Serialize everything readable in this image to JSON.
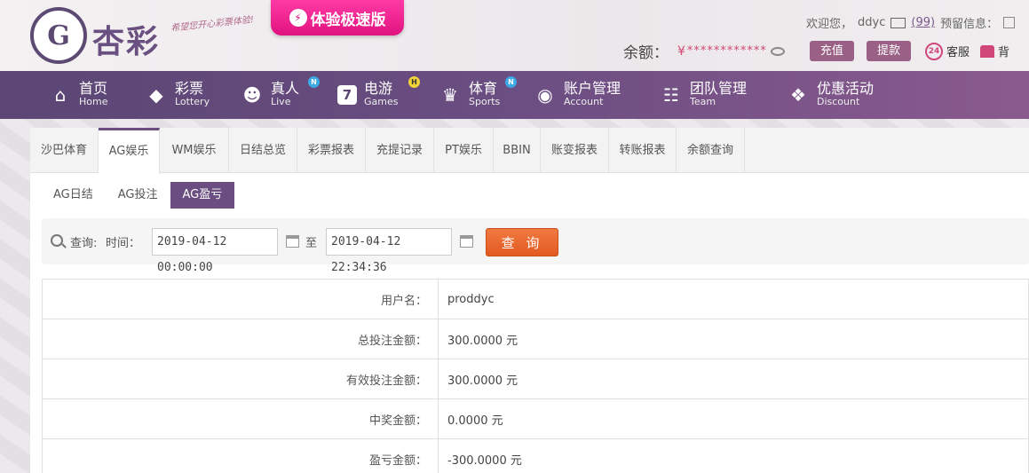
{
  "header": {
    "logo_mark": "G",
    "logo_text": "杏彩",
    "slogan": "希望您开心彩票体验!",
    "speed_label": "体验极速版",
    "welcome": "欢迎您，",
    "username": "ddyc",
    "mail_count": "(99)",
    "reserve_info": "预留信息：",
    "balance_label": "余额：",
    "currency": "¥",
    "balance_masked": "************",
    "recharge_label": "充值",
    "withdraw_label": "提款",
    "service_badge": "24",
    "service_label": "客服",
    "theme_label": "背"
  },
  "nav": [
    {
      "cn": "首页",
      "en": "Home",
      "icon": "home-icon",
      "glyph": "⌂",
      "badge": ""
    },
    {
      "cn": "彩票",
      "en": "Lottery",
      "icon": "ticket-icon",
      "glyph": "◆",
      "badge": ""
    },
    {
      "cn": "真人",
      "en": "Live",
      "icon": "live-dealer-icon",
      "glyph": "☻",
      "badge": "N"
    },
    {
      "cn": "电游",
      "en": "Games",
      "icon": "slot-seven-icon",
      "glyph": "7",
      "badge": "H"
    },
    {
      "cn": "体育",
      "en": "Sports",
      "icon": "trophy-icon",
      "glyph": "♛",
      "badge": "N"
    },
    {
      "cn": "账户管理",
      "en": "Account",
      "icon": "account-icon",
      "glyph": "◉",
      "badge": ""
    },
    {
      "cn": "团队管理",
      "en": "Team",
      "icon": "team-icon",
      "glyph": "☷",
      "badge": ""
    },
    {
      "cn": "优惠活动",
      "en": "Discount",
      "icon": "gift-icon",
      "glyph": "❖",
      "badge": ""
    }
  ],
  "tabs": [
    "沙巴体育",
    "AG娱乐",
    "WM娱乐",
    "日结总览",
    "彩票报表",
    "充提记录",
    "PT娱乐",
    "BBIN",
    "账变报表",
    "转账报表",
    "余额查询"
  ],
  "active_tab": "AG娱乐",
  "subtabs": [
    "AG日结",
    "AG投注",
    "AG盈亏"
  ],
  "active_subtab": "AG盈亏",
  "query": {
    "label": "查询:",
    "time_label": "时间：",
    "start": "2019-04-12 00:00:00",
    "separator": "至",
    "end": "2019-04-12 22:34:36",
    "button": "查 询"
  },
  "results": [
    {
      "label": "用户名：",
      "value": "proddyc"
    },
    {
      "label": "总投注金额：",
      "value": "300.0000 元"
    },
    {
      "label": "有效投注金额：",
      "value": "300.0000 元"
    },
    {
      "label": "中奖金额：",
      "value": "0.0000 元"
    },
    {
      "label": "盈亏金额：",
      "value": "-300.0000 元"
    }
  ],
  "colors": {
    "primary": "#6a4e82",
    "accent": "#d04a72",
    "query_button": "#e25a22",
    "speed_button": "#e0137f"
  }
}
